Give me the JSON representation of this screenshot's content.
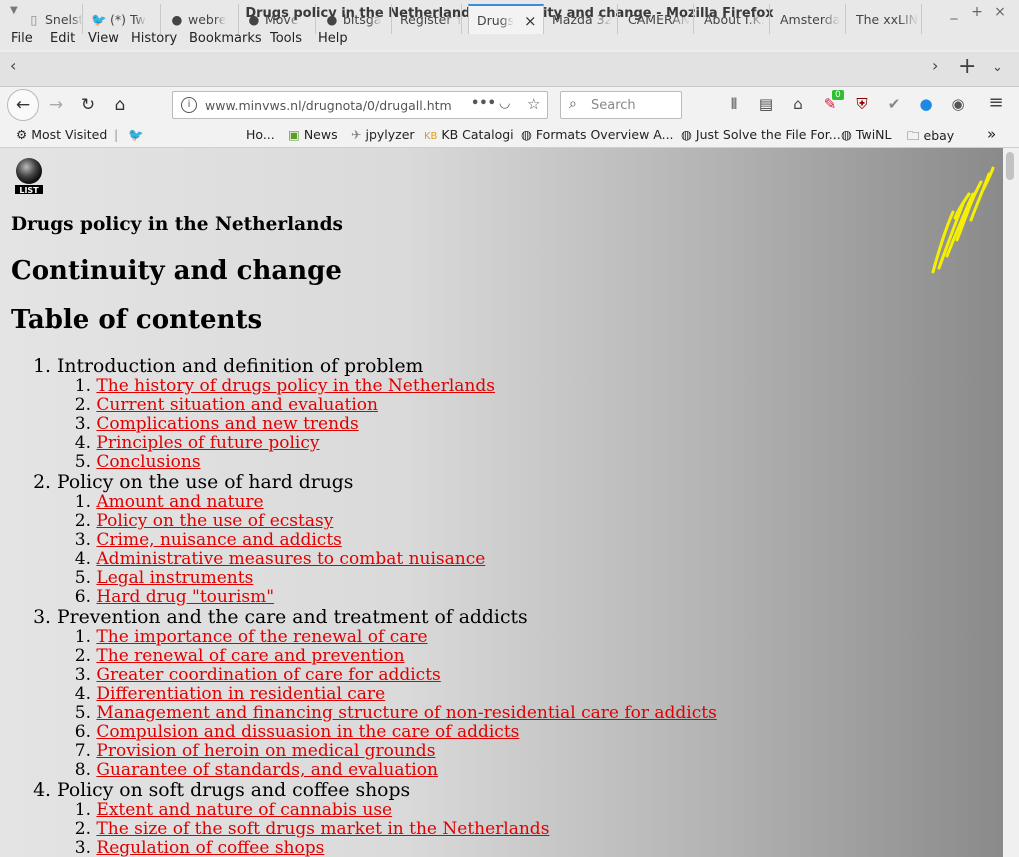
{
  "window": {
    "title": "Drugs policy in the Netherlands: continuity and change - Mozilla Firefox",
    "controls": [
      "_",
      "+",
      "×"
    ]
  },
  "menu": [
    "File",
    "Edit",
    "View",
    "History",
    "Bookmarks",
    "Tools",
    "Help"
  ],
  "tabs": [
    {
      "label": "Snelst",
      "icon": "page-icon"
    },
    {
      "label": "(*) Tw",
      "icon": "twitter-icon"
    },
    {
      "label": "webre",
      "icon": "github-icon"
    },
    {
      "label": "Move",
      "icon": "github-icon"
    },
    {
      "label": "bitsga",
      "icon": "github-icon"
    },
    {
      "label": "Register Y",
      "icon": ""
    },
    {
      "label": "Drugs",
      "icon": "",
      "active": true,
      "close": "×"
    },
    {
      "label": "Mazda 32",
      "icon": ""
    },
    {
      "label": "CAMERAN",
      "icon": ""
    },
    {
      "label": "About I.K.",
      "icon": ""
    },
    {
      "label": "Amsterda",
      "icon": ""
    },
    {
      "label": "The xxLIN",
      "icon": ""
    }
  ],
  "navbar": {
    "url": "www.minvws.nl/drugnota/0/drugall.htm",
    "search_placeholder": "Search",
    "badge": "0"
  },
  "bookmarks": [
    {
      "label": "Most Visited",
      "icon": "gear-icon"
    },
    {
      "label": "",
      "icon": "twitter-icon"
    },
    {
      "label": "Ho...",
      "icon": ""
    },
    {
      "label": "News",
      "icon": "mint-icon"
    },
    {
      "label": "jpylyzer",
      "icon": "rocket-icon"
    },
    {
      "label": "KB Catalogi",
      "icon": "kb-icon"
    },
    {
      "label": "Formats Overview A...",
      "icon": "globe-icon"
    },
    {
      "label": "Just Solve the File For...",
      "icon": "globe-icon"
    },
    {
      "label": "TwiNL",
      "icon": "globe-icon"
    },
    {
      "label": "ebay",
      "icon": "folder-icon"
    }
  ],
  "page": {
    "logo_text": "LIST",
    "heading_small": "Drugs policy in the Netherlands",
    "heading_big": "Continuity and change",
    "toc_title": "Table of contents",
    "sections": [
      {
        "num": "1.",
        "title": "Introduction and definition of problem",
        "items": [
          "The history of drugs policy in the Netherlands",
          "Current situation and evaluation",
          "Complications and new trends",
          "Principles of future policy",
          "Conclusions"
        ]
      },
      {
        "num": "2.",
        "title": "Policy on the use of hard drugs",
        "items": [
          "Amount and nature",
          "Policy on the use of ecstasy",
          "Crime, nuisance and addicts",
          "Administrative measures to combat nuisance",
          "Legal instruments",
          "Hard drug \"tourism\""
        ]
      },
      {
        "num": "3.",
        "title": "Prevention and the care and treatment of addicts",
        "items": [
          "The importance of the renewal of care",
          "The renewal of care and prevention",
          "Greater coordination of care for addicts",
          "Differentiation in residential care",
          "Management and financing structure of non-residential care for addicts",
          "Compulsion and dissuasion in the care of addicts",
          "Provision of heroin on medical grounds",
          "Guarantee of standards, and evaluation"
        ]
      },
      {
        "num": "4.",
        "title": "Policy on soft drugs and coffee shops",
        "items": [
          "Extent and nature of cannabis use",
          "The size of the soft drugs market in the Netherlands",
          "Regulation of coffee shops"
        ]
      }
    ]
  }
}
